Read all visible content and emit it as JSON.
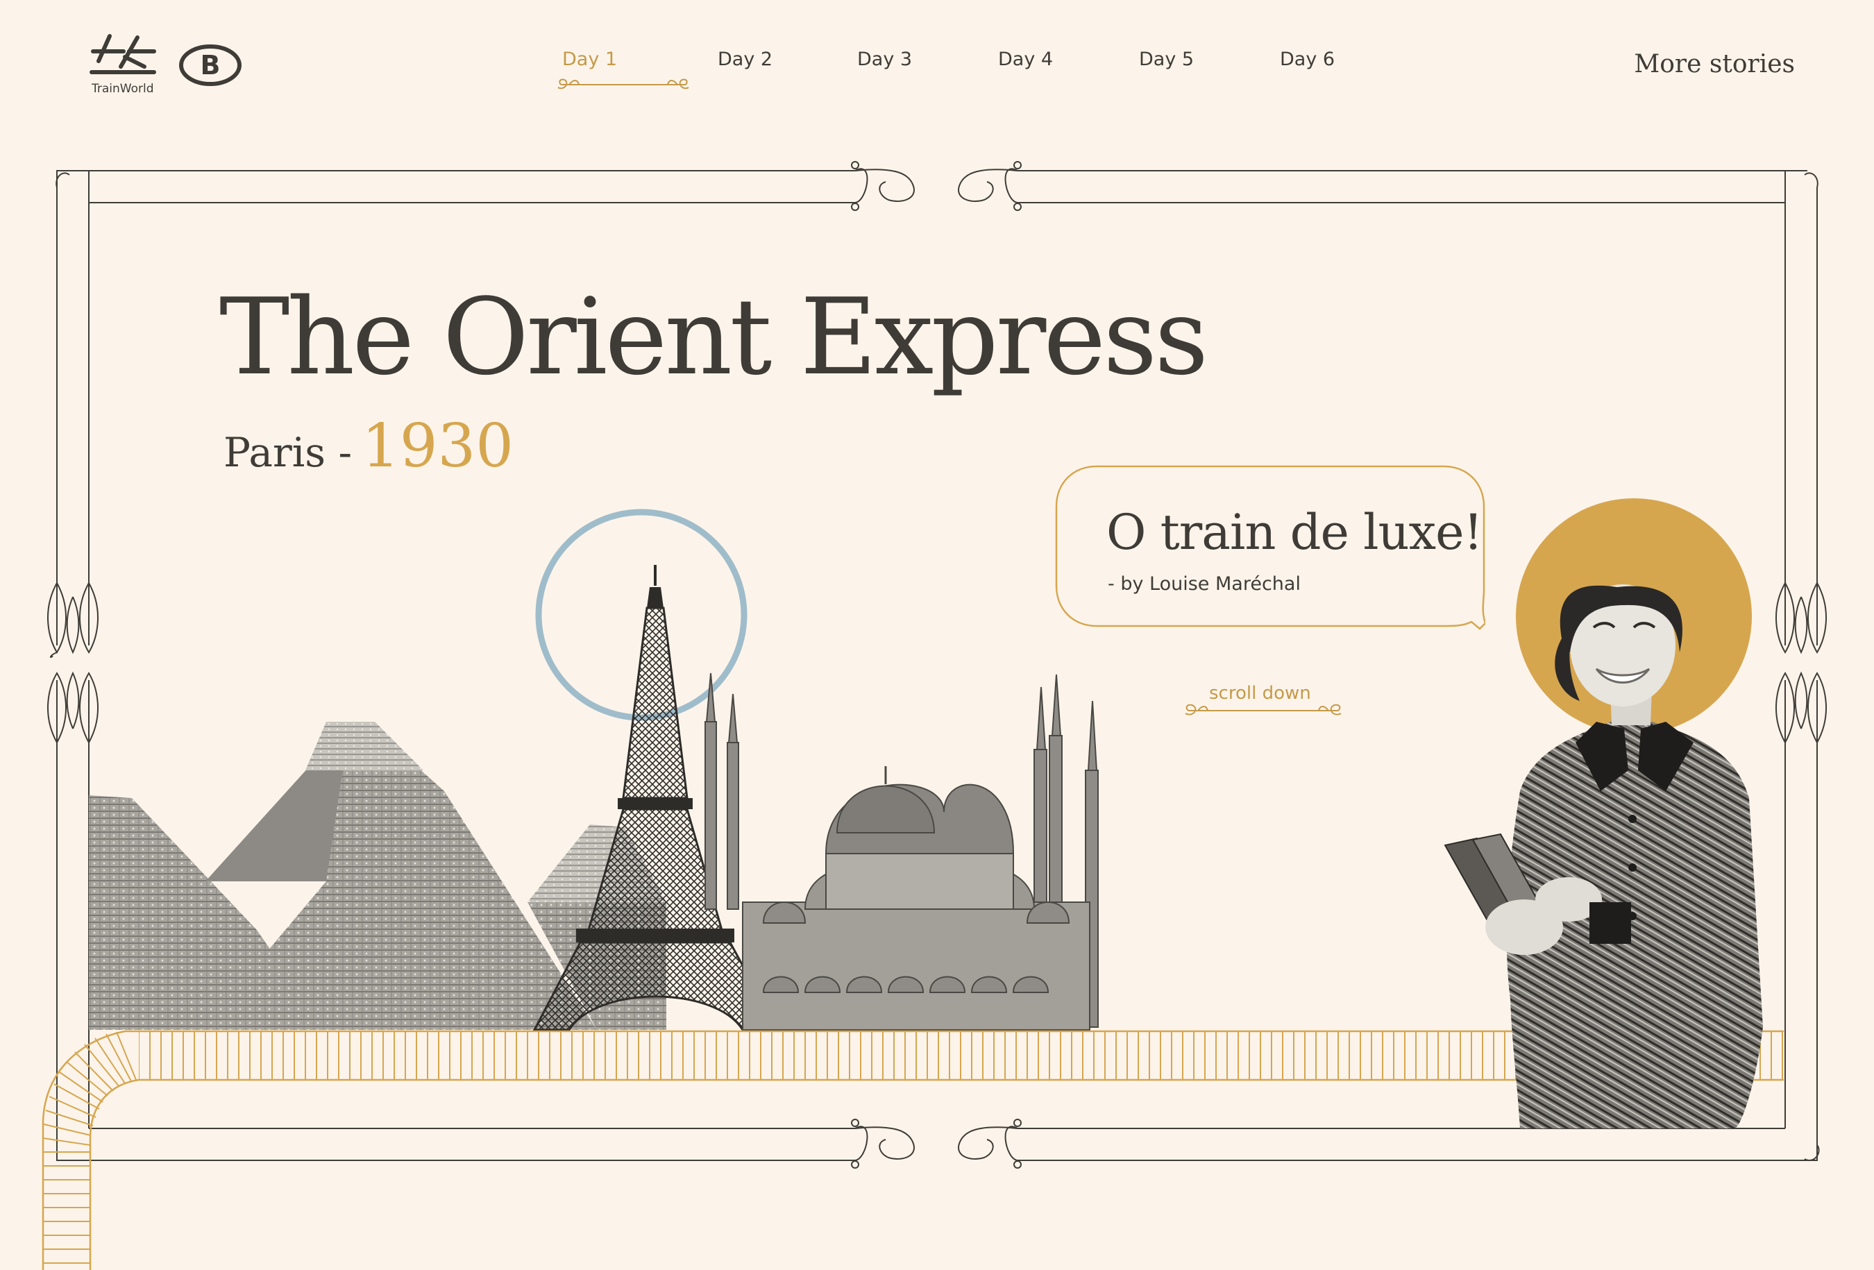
{
  "brand": {
    "trainworld_label": "TrainWorld",
    "sncb_letter": "B"
  },
  "nav": {
    "items": [
      {
        "label": "Day 1",
        "active": true
      },
      {
        "label": "Day 2",
        "active": false
      },
      {
        "label": "Day 3",
        "active": false
      },
      {
        "label": "Day 4",
        "active": false
      },
      {
        "label": "Day 5",
        "active": false
      },
      {
        "label": "Day 6",
        "active": false
      }
    ],
    "more_stories": "More stories"
  },
  "hero": {
    "title": "The Orient Express",
    "city": "Paris -",
    "year": "1930"
  },
  "quote": {
    "text": "O train de luxe!",
    "byline": "- by Louise Maréchal"
  },
  "scroll": {
    "label": "scroll down"
  },
  "colors": {
    "background": "#fcf4ea",
    "ink": "#3f3c37",
    "gold": "#d6a64f",
    "accent_blue": "#9fbccb"
  },
  "icons": [
    "trainworld-logo-icon",
    "sncb-logo-icon",
    "ornament-icon",
    "track-icon"
  ]
}
